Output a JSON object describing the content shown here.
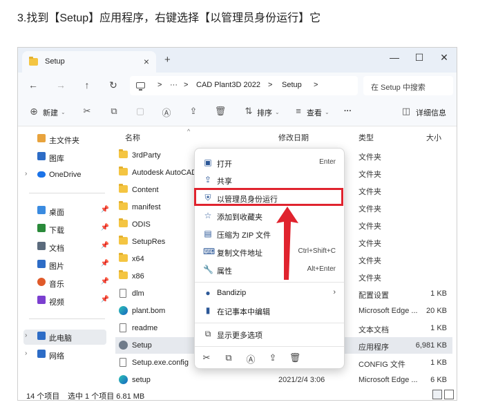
{
  "caption": "3.找到【Setup】应用程序，右键选择【以管理员身份运行】它",
  "window": {
    "tab_title": "Setup",
    "tab_close": "×",
    "new_tab": "+",
    "minimize": "—",
    "maximize": "☐",
    "close": "✕"
  },
  "address": {
    "back": "←",
    "forward": "→",
    "up": "↑",
    "refresh": "↻",
    "crumbs": [
      ">",
      "···",
      ">",
      "CAD Plant3D 2022",
      ">",
      "Setup",
      ">"
    ],
    "search_placeholder": "在 Setup 中搜索"
  },
  "toolbar": {
    "new_label": "新建",
    "sort_label": "排序",
    "view_label": "查看",
    "more": "···",
    "details_label": "详细信息"
  },
  "sidebar": {
    "items": [
      {
        "label": "主文件夹",
        "icon": "home-icon",
        "color": "#e8a33d"
      },
      {
        "label": "图库",
        "icon": "gallery-icon",
        "color": "#2d6cc6"
      },
      {
        "label": "OneDrive",
        "icon": "cloud-icon",
        "color": "#1b73e8"
      },
      {
        "label": "桌面",
        "icon": "desktop-icon",
        "color": "#3a8be0"
      },
      {
        "label": "下载",
        "icon": "download-icon",
        "color": "#2a8a3a"
      },
      {
        "label": "文档",
        "icon": "document-icon",
        "color": "#5b6b7d"
      },
      {
        "label": "图片",
        "icon": "picture-icon",
        "color": "#2d6cc6"
      },
      {
        "label": "音乐",
        "icon": "music-icon",
        "color": "#e05a2a"
      },
      {
        "label": "视频",
        "icon": "video-icon",
        "color": "#7b3fd0"
      },
      {
        "label": "此电脑",
        "icon": "computer-icon",
        "color": "#2d6cc6"
      },
      {
        "label": "网络",
        "icon": "network-icon",
        "color": "#2d6cc6"
      }
    ]
  },
  "columns": {
    "name": "名称",
    "modified": "修改日期",
    "type": "类型",
    "size": "大小"
  },
  "files": [
    {
      "name": "3rdParty",
      "kind": "folder",
      "modified": "",
      "type": "文件夹",
      "size": ""
    },
    {
      "name": "Autodesk AutoCAD",
      "kind": "folder",
      "modified": "",
      "type": "文件夹",
      "size": ""
    },
    {
      "name": "Content",
      "kind": "folder",
      "modified": "",
      "type": "文件夹",
      "size": ""
    },
    {
      "name": "manifest",
      "kind": "folder",
      "modified": "",
      "type": "文件夹",
      "size": ""
    },
    {
      "name": "ODIS",
      "kind": "folder",
      "modified": "",
      "type": "文件夹",
      "size": ""
    },
    {
      "name": "SetupRes",
      "kind": "folder",
      "modified": "",
      "type": "文件夹",
      "size": ""
    },
    {
      "name": "x64",
      "kind": "folder",
      "modified": "",
      "type": "文件夹",
      "size": ""
    },
    {
      "name": "x86",
      "kind": "folder",
      "modified": "",
      "type": "文件夹",
      "size": ""
    },
    {
      "name": "dlm",
      "kind": "doc",
      "modified": "",
      "type": "配置设置",
      "size": "1 KB"
    },
    {
      "name": "plant.bom",
      "kind": "edge",
      "modified": "",
      "type": "Microsoft Edge ...",
      "size": "20 KB"
    },
    {
      "name": "readme",
      "kind": "doc",
      "modified": "",
      "type": "文本文档",
      "size": "1 KB"
    },
    {
      "name": "Setup",
      "kind": "gear",
      "modified": "",
      "type": "应用程序",
      "size": "6,981 KB"
    },
    {
      "name": "Setup.exe.config",
      "kind": "doc",
      "modified": "",
      "type": "CONFIG 文件",
      "size": "1 KB"
    },
    {
      "name": "setup",
      "kind": "edge",
      "modified": "2021/2/4 3:06",
      "type": "Microsoft Edge ...",
      "size": "6 KB"
    }
  ],
  "status": {
    "count": "14 个项目",
    "selected": "选中 1 个项目  6.81 MB"
  },
  "context_menu": {
    "items": [
      {
        "label": "打开",
        "shortcut": "Enter",
        "icon": "open-icon"
      },
      {
        "label": "共享",
        "shortcut": "",
        "icon": "share-icon"
      },
      {
        "label": "以管理员身份运行",
        "shortcut": "",
        "icon": "shield-icon"
      },
      {
        "label": "添加到收藏夹",
        "shortcut": "",
        "icon": "star-icon"
      },
      {
        "label": "压缩为 ZIP 文件",
        "shortcut": "",
        "icon": "zip-icon"
      },
      {
        "label": "复制文件地址",
        "shortcut": "Ctrl+Shift+C",
        "icon": "copy-path-icon"
      },
      {
        "label": "属性",
        "shortcut": "Alt+Enter",
        "icon": "wrench-icon"
      },
      {
        "label": "Bandizip",
        "shortcut": "",
        "icon": "bandizip-icon"
      },
      {
        "label": "在记事本中编辑",
        "shortcut": "",
        "icon": "notepad-icon"
      },
      {
        "label": "显示更多选项",
        "shortcut": "",
        "icon": "more-options-icon"
      }
    ],
    "submenu_arrow": "›"
  },
  "colors": {
    "highlight": "#e0232e",
    "folder": "#f4c542",
    "selected_row": "#e6e9ee"
  }
}
